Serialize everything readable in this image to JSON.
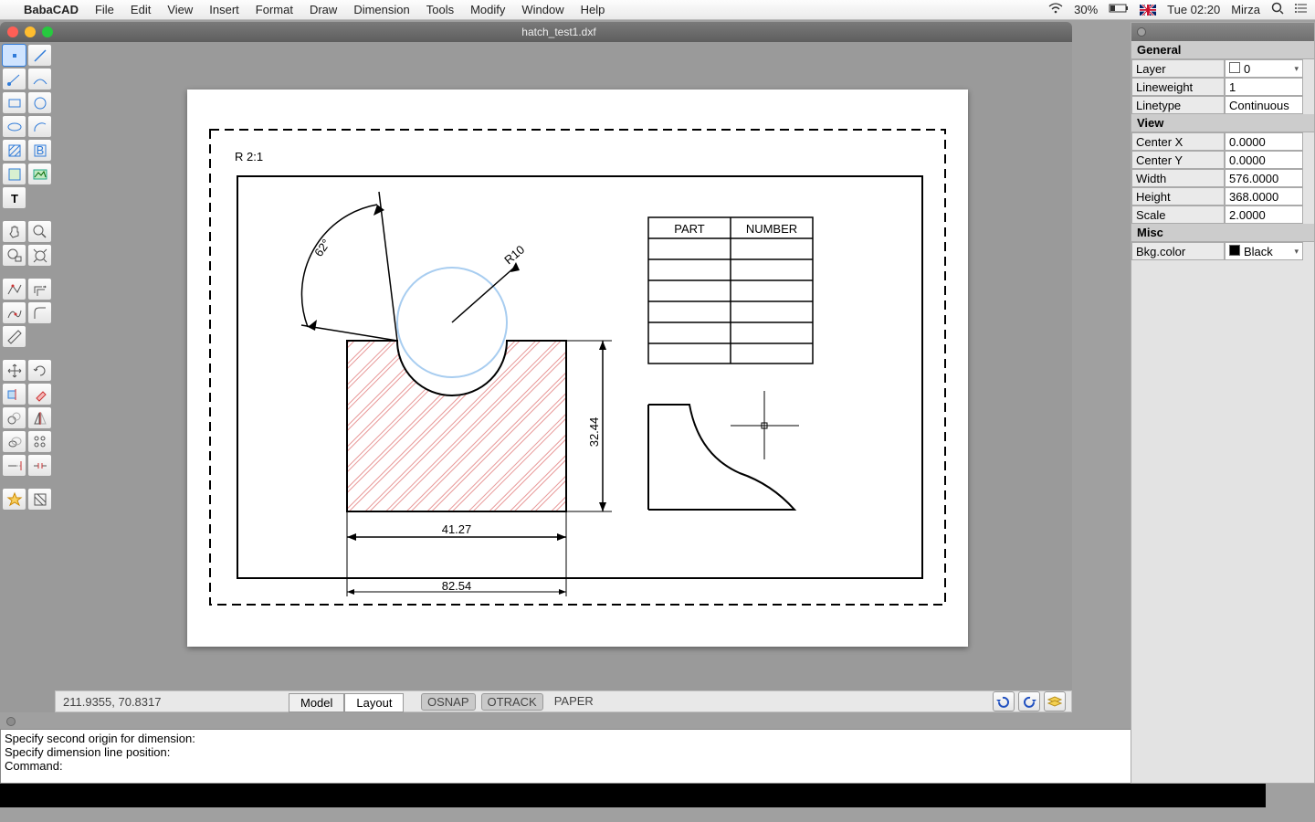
{
  "menubar": {
    "app": "BabaCAD",
    "items": [
      "File",
      "Edit",
      "View",
      "Insert",
      "Format",
      "Draw",
      "Dimension",
      "Tools",
      "Modify",
      "Window",
      "Help"
    ],
    "battery": "30%",
    "clock": "Tue 02:20",
    "user": "Mirza"
  },
  "window": {
    "title": "hatch_test1.dxf"
  },
  "drawing": {
    "scale_label": "R 2:1",
    "dims": {
      "width": "41.27",
      "height": "32.44",
      "outer": "82.54",
      "angle": "62°",
      "radius": "R10"
    },
    "table": {
      "h1": "PART",
      "h2": "NUMBER"
    }
  },
  "status": {
    "coords": "211.9355, 70.8317",
    "model": "Model",
    "layout": "Layout",
    "osnap": "OSNAP",
    "otrack": "OTRACK",
    "paper": "PAPER"
  },
  "cmdlog": {
    "l1": "Specify second origin for dimension:",
    "l2": "Specify dimension line position:",
    "l3": "Command:"
  },
  "props": {
    "s1": "General",
    "layer_k": "Layer",
    "layer_v": "0",
    "lw_k": "Lineweight",
    "lw_v": "1",
    "lt_k": "Linetype",
    "lt_v": "Continuous",
    "s2": "View",
    "cx_k": "Center X",
    "cx_v": "0.0000",
    "cy_k": "Center Y",
    "cy_v": "0.0000",
    "w_k": "Width",
    "w_v": "576.0000",
    "h_k": "Height",
    "h_v": "368.0000",
    "sc_k": "Scale",
    "sc_v": "2.0000",
    "s3": "Misc",
    "bg_k": "Bkg.color",
    "bg_v": "Black"
  }
}
